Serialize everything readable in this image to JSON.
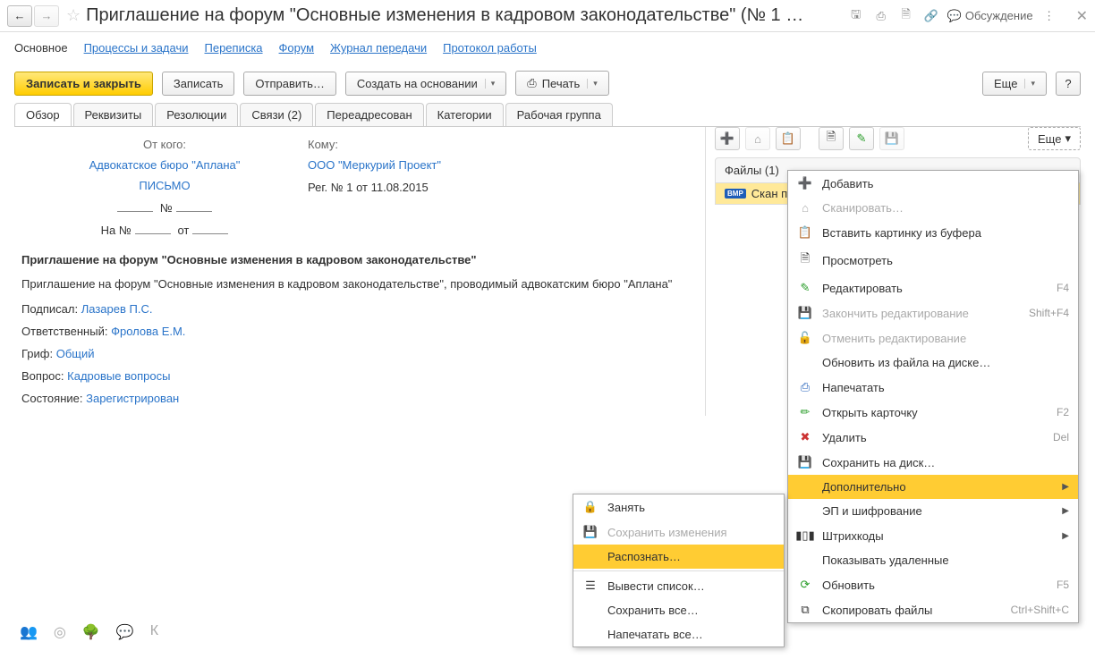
{
  "title": "Приглашение на форум \"Основные изменения в кадровом законодательстве\" (№ 1 …",
  "titleActions": {
    "discussion": "Обсуждение"
  },
  "sectionTabs": [
    "Основное",
    "Процессы и задачи",
    "Переписка",
    "Форум",
    "Журнал передачи",
    "Протокол работы"
  ],
  "actions": {
    "saveClose": "Записать и закрыть",
    "save": "Записать",
    "send": "Отправить…",
    "createBased": "Создать на основании",
    "print": "Печать",
    "more": "Еще",
    "help": "?"
  },
  "lowerTabs": [
    "Обзор",
    "Реквизиты",
    "Резолюции",
    "Связи (2)",
    "Переадресован",
    "Категории",
    "Рабочая группа"
  ],
  "overview": {
    "fromLabel": "От кого:",
    "fromValue": "Адвокатское бюро \"Аплана\"",
    "toLabel": "Кому:",
    "toValue": "ООО \"Меркурий Проект\"",
    "letter": "ПИСЬМО",
    "reg": "Рег. № 1 от 11.08.2015",
    "numLine1a": "",
    "numLine1b": "№",
    "onNum": "На №",
    "fromDate": "от",
    "docTitle": "Приглашение на форум \"Основные изменения в кадровом законодательстве\"",
    "docBody": "Приглашение на форум \"Основные изменения в кадровом законодательстве\", проводимый адвокатским бюро \"Аплана\"",
    "signedLabel": "Подписал:",
    "signedValue": "Лазарев П.С.",
    "respLabel": "Ответственный:",
    "respValue": "Фролова Е.М.",
    "grifLabel": "Гриф:",
    "grifValue": "Общий",
    "questionLabel": "Вопрос:",
    "questionValue": "Кадровые вопросы",
    "stateLabel": "Состояние:",
    "stateValue": "Зарегистрирован"
  },
  "rightPanel": {
    "moreBtn": "Еще",
    "filesHeader": "Файлы (1)",
    "fileName": "Скан письма"
  },
  "menuMain": [
    {
      "icon": "plus",
      "label": "Добавить",
      "type": "item"
    },
    {
      "icon": "scan",
      "label": "Сканировать…",
      "type": "disabled"
    },
    {
      "icon": "paste",
      "label": "Вставить картинку из буфера",
      "type": "item"
    },
    {
      "icon": "doc",
      "label": "Просмотреть",
      "type": "item"
    },
    {
      "icon": "edit",
      "label": "Редактировать",
      "shortcut": "F4",
      "type": "item"
    },
    {
      "icon": "endedit",
      "label": "Закончить редактирование",
      "shortcut": "Shift+F4",
      "type": "disabled"
    },
    {
      "icon": "cancel",
      "label": "Отменить редактирование",
      "type": "disabled"
    },
    {
      "icon": "",
      "label": "Обновить из файла на диске…",
      "type": "item"
    },
    {
      "icon": "print",
      "label": "Напечатать",
      "type": "item"
    },
    {
      "icon": "card",
      "label": "Открыть карточку",
      "shortcut": "F2",
      "type": "item"
    },
    {
      "icon": "del",
      "label": "Удалить",
      "shortcut": "Del",
      "type": "item"
    },
    {
      "icon": "save",
      "label": "Сохранить на диск…",
      "type": "item"
    },
    {
      "icon": "",
      "label": "Дополнительно",
      "arrow": true,
      "type": "highlight"
    },
    {
      "icon": "",
      "label": "ЭП и шифрование",
      "arrow": true,
      "type": "item"
    },
    {
      "icon": "barcode",
      "label": "Штрихкоды",
      "arrow": true,
      "type": "item"
    },
    {
      "icon": "",
      "label": "Показывать удаленные",
      "type": "item"
    },
    {
      "icon": "refresh",
      "label": "Обновить",
      "shortcut": "F5",
      "type": "item"
    },
    {
      "icon": "copy",
      "label": "Скопировать файлы",
      "shortcut": "Ctrl+Shift+C",
      "type": "item"
    }
  ],
  "menuSub": [
    {
      "icon": "lock",
      "label": "Занять",
      "type": "item"
    },
    {
      "icon": "savechg",
      "label": "Сохранить изменения",
      "type": "disabled"
    },
    {
      "icon": "",
      "label": "Распознать…",
      "type": "highlight"
    },
    {
      "type": "sep"
    },
    {
      "icon": "list",
      "label": "Вывести список…",
      "type": "item"
    },
    {
      "icon": "",
      "label": "Сохранить все…",
      "type": "item"
    },
    {
      "icon": "",
      "label": "Напечатать все…",
      "type": "item"
    }
  ]
}
